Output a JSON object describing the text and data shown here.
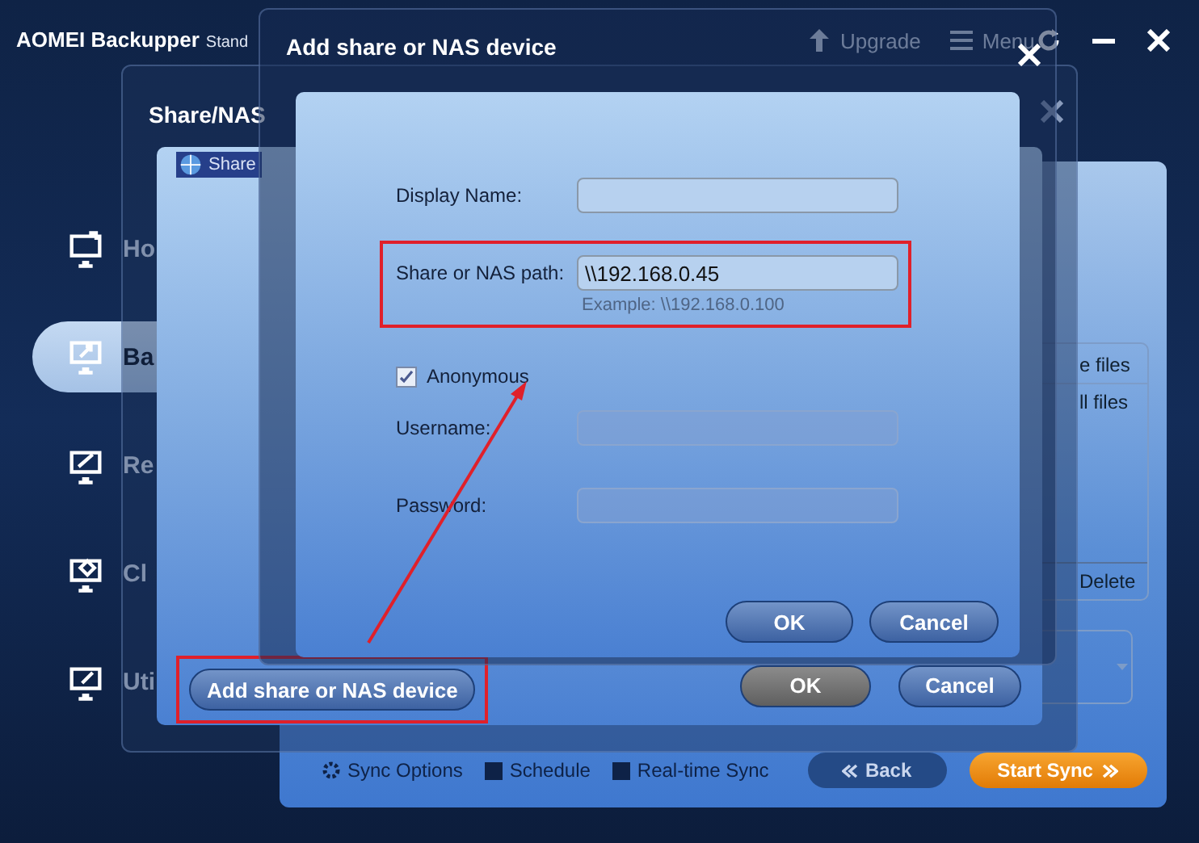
{
  "app": {
    "title": "AOMEI Backupper",
    "edition": "Stand",
    "toolbar": [
      {
        "kind": "upgrade",
        "label": "Upgrade"
      },
      {
        "kind": "menu",
        "label": "Menu"
      }
    ],
    "sidebar": [
      {
        "kind": "home",
        "label": "Ho",
        "selected": false
      },
      {
        "kind": "backup",
        "label": "Ba",
        "selected": true
      },
      {
        "kind": "restore",
        "label": "Re",
        "selected": false
      },
      {
        "kind": "clone",
        "label": "Cl",
        "selected": false
      },
      {
        "kind": "utilities",
        "label": "Uti",
        "selected": false
      }
    ],
    "content": {
      "list_header": "e files",
      "list_item": "ll files",
      "delete": "Delete",
      "options": [
        {
          "kind": "gear",
          "label": "Sync Options"
        },
        {
          "kind": "box",
          "label": "Schedule"
        },
        {
          "kind": "box",
          "label": "Real-time Sync"
        }
      ],
      "back": "Back",
      "start": "Start Sync"
    }
  },
  "share_window": {
    "title": "Share/NAS",
    "tab": "Share",
    "add_button": {
      "label": "Add share or NAS device",
      "highlighted": true
    },
    "ok": "OK",
    "cancel": "Cancel"
  },
  "dialog": {
    "title": "Add share or NAS device",
    "rows": [
      {
        "kind": "field",
        "label": "Display Name:",
        "disabled": false,
        "highlighted": false
      },
      {
        "kind": "field",
        "label": "Share or NAS path:",
        "value": "\\\\192.168.0.45",
        "hint": "Example: \\\\192.168.0.100",
        "disabled": false,
        "highlighted": true
      },
      {
        "kind": "checkbox",
        "label": "Anonymous",
        "checked": true
      },
      {
        "kind": "field",
        "label": "Username:",
        "disabled": true,
        "highlighted": false
      },
      {
        "kind": "field",
        "label": "Password:",
        "disabled": true,
        "highlighted": false
      }
    ],
    "ok": "OK",
    "cancel": "Cancel"
  }
}
